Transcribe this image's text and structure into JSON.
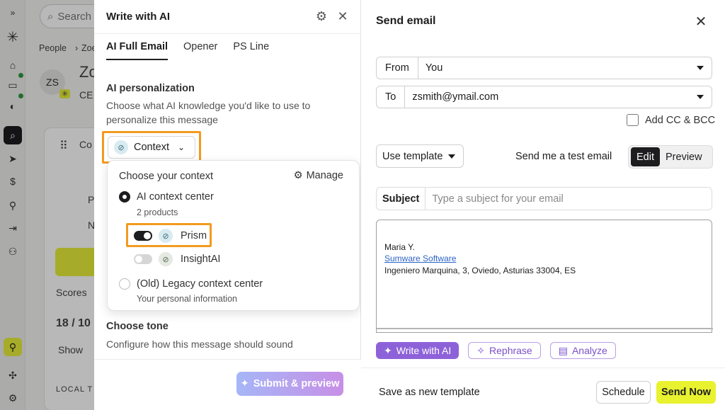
{
  "background": {
    "search_placeholder": "Search",
    "breadcrumb_root": "People",
    "breadcrumb_current": "Zoe",
    "avatar_initials": "ZS",
    "person_name_fragment": "Zo",
    "title_fragment": "CE",
    "card_title_fragment": "Co",
    "scores_label": "Scores",
    "score_value": "18 / 10",
    "show_label": "Show",
    "local_label": "LOCAL T",
    "row_letter_p": "P",
    "row_letter_n": "N"
  },
  "ai_panel": {
    "title": "Write with AI",
    "tabs": [
      {
        "label": "AI Full Email"
      },
      {
        "label": "Opener"
      },
      {
        "label": "PS Line"
      }
    ],
    "personalization_title": "AI personalization",
    "personalization_desc": "Choose what AI knowledge you'd like to use to personalize this message",
    "context_button": "Context",
    "dropdown": {
      "header": "Choose your context",
      "manage_label": "Manage",
      "options": [
        {
          "label": "AI context center",
          "sub": "2 products",
          "selected": true
        },
        {
          "label": "(Old) Legacy context center",
          "sub": "Your personal information",
          "selected": false
        }
      ],
      "products": [
        {
          "name": "Prism",
          "enabled": true
        },
        {
          "name": "InsightAI",
          "enabled": false
        }
      ]
    },
    "tone_title": "Choose tone",
    "tone_desc": "Configure how this message should sound",
    "submit_label": "Submit & preview"
  },
  "email_panel": {
    "title": "Send email",
    "from_label": "From",
    "from_value": "You",
    "to_label": "To",
    "to_value": "zsmith@ymail.com",
    "cc_bcc_label": "Add CC & BCC",
    "use_template_label": "Use template",
    "test_email_label": "Send me a test email",
    "edit_label": "Edit",
    "preview_label": "Preview",
    "subject_label": "Subject",
    "subject_placeholder": "Type a subject for your email",
    "signature": {
      "name": "Maria Y.",
      "company": "Sumware Software",
      "address": "Ingeniero Marquina, 3, Oviedo, Asturias 33004, ES"
    },
    "write_ai_label": "Write with AI",
    "rephrase_label": "Rephrase",
    "analyze_label": "Analyze",
    "save_template_label": "Save as new template",
    "schedule_label": "Schedule",
    "send_now_label": "Send Now"
  },
  "colors": {
    "highlight": "#f39a1e",
    "send_button": "#e8f22e",
    "ai_purple": "#8d62d9",
    "submit_gradient_start": "#a6b6f7",
    "submit_gradient_end": "#c78fe6"
  }
}
